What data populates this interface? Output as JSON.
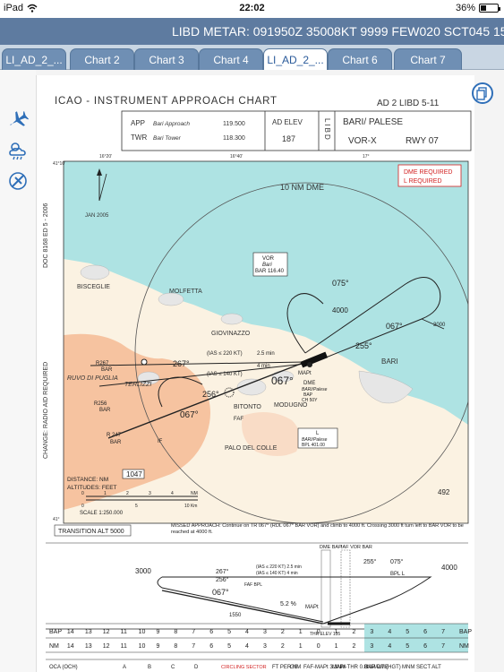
{
  "status": {
    "device": "iPad",
    "time": "22:02",
    "battery": "36%",
    "battery_fraction": 0.36
  },
  "metar": "LIBD METAR: 091950Z 35008KT 9999 FEW020 SCT045 15/12 Q1017",
  "tabs": [
    {
      "label": "LI_AD_2_...",
      "active": false
    },
    {
      "label": "Chart 2",
      "active": false
    },
    {
      "label": "Chart 3",
      "active": false
    },
    {
      "label": "Chart 4",
      "active": false
    },
    {
      "label": "LI_AD_2_...",
      "active": true
    },
    {
      "label": "Chart 6",
      "active": false
    },
    {
      "label": "Chart 7",
      "active": false
    }
  ],
  "rail": {
    "icons": [
      "airplane-icon",
      "weather-icon",
      "satellite-icon"
    ]
  },
  "colors": {
    "sea": "#aee3e3",
    "land": "#fbf2e2",
    "high_terrain": "#f6c3a0",
    "tab": "#6f8fb4",
    "metar": "#5e7ba0",
    "red": "#d22222"
  },
  "chart": {
    "title": "ICAO  -  INSTRUMENT  APPROACH  CHART",
    "ref": "AD 2  LIBD 5-11",
    "app_label": "APP",
    "app_name": "Bari Approach",
    "app_freq": "119.500",
    "twr_label": "TWR",
    "twr_name": "Bari Tower",
    "twr_freq": "118.300",
    "ad_elev_label": "AD ELEV",
    "ad_elev_value": "187",
    "libd_vertical": "LIBD",
    "airport": "BARI/ PALESE",
    "procedure": "VOR-X",
    "runway": "RWY 07",
    "side_text": "CHANGE: RADIO AID REQUIRED",
    "doc_text": "DOC 8168  ED 5 - 2006",
    "dme_required": "DME   REQUIRED",
    "l_required": "L   REQUIRED",
    "ten_nm_dme": "10 NM DME",
    "variation_date": "JAN 2005",
    "towns": [
      "BISCEGLIE",
      "MOLFETTA",
      "GIOVINAZZO",
      "BARI",
      "RUVO DI PUGLIA",
      "TERLIZZI",
      "BITONTO",
      "MODUGNO",
      "PALO DEL COLLE"
    ],
    "vor_box": [
      "VOR",
      "Bari",
      "BAR 116.40"
    ],
    "dme_box": [
      "DME",
      "BARI/Palese",
      "BAP",
      "CH 50Y"
    ],
    "l_box": [
      "L",
      "BARI/Palese",
      "BPL 401.00"
    ],
    "tracks": [
      "075°",
      "067°",
      "255°",
      "256°",
      "267°",
      "067°",
      "067°"
    ],
    "altitudes": [
      "4000",
      "3000",
      "3000"
    ],
    "radials": [
      "R267",
      "BAR",
      "R256",
      "BAR",
      "R 247",
      "BAR"
    ],
    "ias_notes": [
      "(IAS ≤ 220 KT)",
      "2.5 min",
      "(IAS ≤ 140 KT)",
      "4 min"
    ],
    "fixes": [
      "FAF",
      "MAPt",
      "IF",
      "D 10",
      "D 4"
    ],
    "spot_height": "1047",
    "spot_height_2": "492",
    "distance_note": "DISTANCE:  NM",
    "altitude_note": "ALTITUDES:  FEET",
    "scale": "SCALE 1:250.000",
    "scale_ticks": [
      "0",
      "1",
      "2",
      "3",
      "4",
      "5",
      "NM"
    ],
    "scale_ticks_km": [
      "0",
      "5",
      "10 Km"
    ],
    "grid_labels": [
      "41°",
      "16°20'",
      "16°40'",
      "17°",
      "41°10'"
    ],
    "transition_alt": "TRANSITION ALT 5000",
    "missed_approach": "MISSED APPROACH: Continue on TR 067° (RDL 067° BAR VOR) and climb to 4000 ft. Crossing 3000 ft turn left to BAR VOR to be reached at 4000 ft.",
    "profile_labels": [
      "DME BAP",
      "IAF VOR BAR",
      "255°",
      "075°",
      "BPL L",
      "4000",
      "3000",
      "267°",
      "256°",
      "067°",
      "FAF BPL",
      "MAPt",
      "1550",
      "5.2 %",
      "THR ELEV 135",
      "(IAS ≤ 220 KT) 2.5 min",
      "(IAS ≤ 140 KT) 4 min"
    ],
    "dist_row1": [
      "BAP",
      "14",
      "13",
      "12",
      "11",
      "10",
      "9",
      "8",
      "7",
      "6",
      "5",
      "4",
      "3",
      "2",
      "1",
      "0",
      "1",
      "2",
      "3",
      "4",
      "5",
      "6",
      "7",
      "BAP"
    ],
    "dist_row2": [
      "NM",
      "14",
      "13",
      "12",
      "11",
      "10",
      "9",
      "8",
      "7",
      "6",
      "5",
      "4",
      "3",
      "2",
      "1",
      "0",
      "1",
      "2",
      "3",
      "4",
      "5",
      "6",
      "7",
      "NM"
    ],
    "bottom_headers": [
      "OCA (OCH)",
      "A",
      "B",
      "C",
      "D",
      "CIRCLING SECTOR",
      "FT PER NM",
      "GS",
      "FAF-MAPt 3.3NM",
      "MAPt-THR 0.8NM",
      "BAP DME",
      "ALT (HGT)",
      "MNM SECT ALT"
    ]
  }
}
